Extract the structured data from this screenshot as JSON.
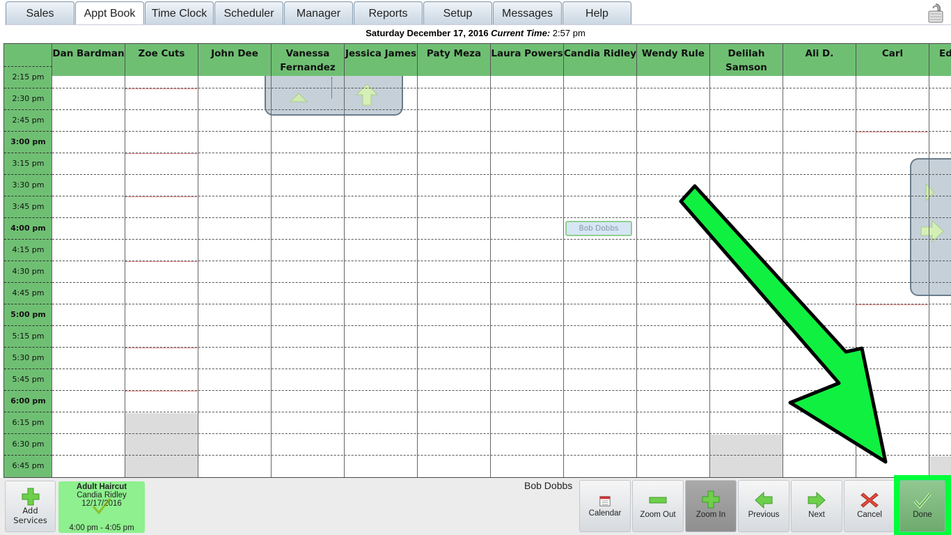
{
  "tabs": [
    {
      "label": "Sales"
    },
    {
      "label": "Appt Book",
      "active": true
    },
    {
      "label": "Time Clock"
    },
    {
      "label": "Scheduler"
    },
    {
      "label": "Manager"
    },
    {
      "label": "Reports"
    },
    {
      "label": "Setup"
    },
    {
      "label": "Messages"
    },
    {
      "label": "Help"
    }
  ],
  "datebar": {
    "date": "Saturday December 17, 2016",
    "current_time_label": "Current Time:",
    "current_time": "2:57 pm"
  },
  "staff": [
    "Dan Bardman",
    "Zoe Cuts",
    "John Dee",
    "Vanessa Fernandez",
    "Jessica James",
    "Paty Meza",
    "Laura Powers",
    "Candia Ridley",
    "Wendy Rule",
    "Delilah Samson",
    "Ali D.",
    "Carl",
    "Ed"
  ],
  "times": [
    "2:15 pm",
    "2:30 pm",
    "2:45 pm",
    "3:00 pm",
    "3:15 pm",
    "3:30 pm",
    "3:45 pm",
    "4:00 pm",
    "4:15 pm",
    "4:30 pm",
    "4:45 pm",
    "5:00 pm",
    "5:15 pm",
    "5:30 pm",
    "5:45 pm",
    "6:00 pm",
    "6:15 pm",
    "6:30 pm",
    "6:45 pm"
  ],
  "appointment": {
    "client": "Bob Dobbs"
  },
  "bottom": {
    "add_services_line1": "Add",
    "add_services_line2": "Services",
    "service_title": "Adult Haircut",
    "service_staff": "Candia Ridley",
    "service_date": "12/17/2016",
    "service_time": "4:00 pm - 4:05 pm",
    "customer_name": "Bob Dobbs",
    "buttons": {
      "calendar": "Calendar",
      "zoom_out": "Zoom Out",
      "zoom_in": "Zoom In",
      "previous": "Previous",
      "next": "Next",
      "cancel": "Cancel",
      "done": "Done"
    }
  },
  "colors": {
    "header_green": "#6fbf73",
    "service_card": "#8ef08e",
    "highlight": "#00ff3a"
  }
}
